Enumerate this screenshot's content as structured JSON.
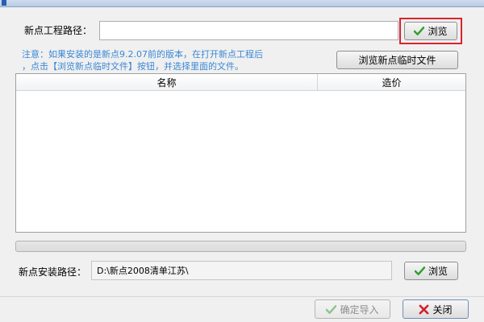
{
  "window": {
    "title": ""
  },
  "project": {
    "path_label": "新点工程路径：",
    "path_value": "",
    "browse_label": "浏览"
  },
  "note": {
    "line1": "注意：如果安装的是新点9.2.07前的版本，在打开新点工程后",
    "line2": "，点击【浏览新点临时文件】按钮，并选择里面的文件。"
  },
  "temp_button_label": "浏览新点临时文件",
  "table": {
    "columns": [
      "名称",
      "造价"
    ],
    "rows": []
  },
  "progress": {
    "value": 0
  },
  "install": {
    "path_label": "新点安装路径：",
    "path_value": "D:\\新点2008清单江苏\\",
    "browse_label": "浏览"
  },
  "footer": {
    "confirm_label": "确定导入",
    "close_label": "关闭"
  },
  "colors": {
    "note": "#3a87d6",
    "focus": "#d9232e",
    "check": "#2e9e2e",
    "close_x": "#d0202a"
  }
}
